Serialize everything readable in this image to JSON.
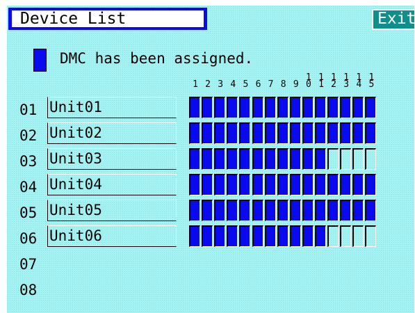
{
  "header": {
    "title": "Device List",
    "exit_label": "Exit"
  },
  "legend": {
    "text": "DMC has been assigned."
  },
  "columns": [
    "1",
    "2",
    "3",
    "4",
    "5",
    "6",
    "7",
    "8",
    "9",
    "1\n0",
    "1\n1",
    "1\n2",
    "1\n3",
    "1\n4",
    "1\n5"
  ],
  "rows": [
    {
      "num": "01",
      "name": "Unit01",
      "assigned": [
        1,
        1,
        1,
        1,
        1,
        1,
        1,
        1,
        1,
        1,
        1,
        1,
        1,
        1,
        1
      ]
    },
    {
      "num": "02",
      "name": "Unit02",
      "assigned": [
        1,
        1,
        1,
        1,
        1,
        1,
        1,
        1,
        1,
        1,
        1,
        1,
        1,
        1,
        1
      ]
    },
    {
      "num": "03",
      "name": "Unit03",
      "assigned": [
        1,
        1,
        1,
        1,
        1,
        1,
        1,
        1,
        1,
        1,
        1,
        0,
        0,
        0,
        0
      ]
    },
    {
      "num": "04",
      "name": "Unit04",
      "assigned": [
        1,
        1,
        1,
        1,
        1,
        1,
        1,
        1,
        1,
        1,
        1,
        1,
        1,
        1,
        1
      ]
    },
    {
      "num": "05",
      "name": "Unit05",
      "assigned": [
        1,
        1,
        1,
        1,
        1,
        1,
        1,
        1,
        1,
        1,
        1,
        1,
        1,
        1,
        1
      ]
    },
    {
      "num": "06",
      "name": "Unit06",
      "assigned": [
        1,
        1,
        1,
        1,
        1,
        1,
        1,
        1,
        1,
        1,
        1,
        0,
        0,
        0,
        0
      ]
    },
    {
      "num": "07",
      "name": "",
      "assigned": []
    },
    {
      "num": "08",
      "name": "",
      "assigned": []
    }
  ],
  "colors": {
    "assigned": "#0a0aee",
    "background": "#a6f2f2",
    "exit_button": "#0e8f8c"
  }
}
